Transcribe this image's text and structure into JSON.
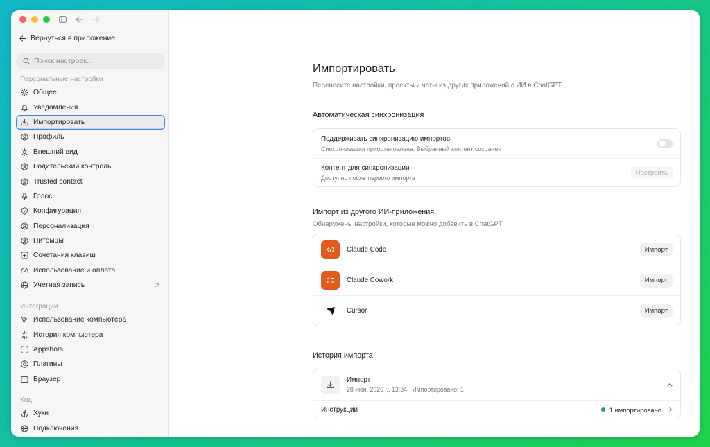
{
  "colors": {
    "accent_blue": "#3b82f6",
    "app_orange": "#e25a1c",
    "status_green": "#22a04b"
  },
  "sidebar": {
    "back_label": "Вернуться в приложение",
    "search_placeholder": "Поиск настроек...",
    "personal_label": "Персональные настройки",
    "personal_items": [
      {
        "label": "Общее",
        "icon": "gear-icon"
      },
      {
        "label": "Уведомления",
        "icon": "bell-icon"
      },
      {
        "label": "Импортировать",
        "icon": "download-icon",
        "active": true
      },
      {
        "label": "Профиль",
        "icon": "user-circle-icon"
      },
      {
        "label": "Внешний вид",
        "icon": "sun-icon"
      },
      {
        "label": "Родительский контроль",
        "icon": "user-circle-icon"
      },
      {
        "label": "Trusted contact",
        "icon": "user-circle-icon"
      },
      {
        "label": "Голос",
        "icon": "microphone-icon"
      },
      {
        "label": "Конфигурация",
        "icon": "shield-icon"
      },
      {
        "label": "Персонализация",
        "icon": "user-circle-icon"
      },
      {
        "label": "Питомцы",
        "icon": "user-circle-icon"
      },
      {
        "label": "Сочетания клавиш",
        "icon": "keyboard-icon"
      },
      {
        "label": "Использование и оплата",
        "icon": "gauge-icon"
      },
      {
        "label": "Учетная запись",
        "icon": "globe-icon",
        "external": true
      }
    ],
    "integrations_label": "Интеграции",
    "integration_items": [
      {
        "label": "Использование компьютера",
        "icon": "cursor-icon"
      },
      {
        "label": "История компьютера",
        "icon": "sparkle-icon"
      },
      {
        "label": "Appshots",
        "icon": "frame-icon"
      },
      {
        "label": "Плагины",
        "icon": "at-icon"
      },
      {
        "label": "Браузер",
        "icon": "browser-icon"
      }
    ],
    "code_label": "Код",
    "code_items": [
      {
        "label": "Хуки",
        "icon": "anchor-icon"
      },
      {
        "label": "Подключения",
        "icon": "globe-icon"
      }
    ]
  },
  "main": {
    "title": "Импортировать",
    "subtitle": "Перенесите настройки, проекты и чаты из других приложений с ИИ в ChatGPT",
    "sync": {
      "title": "Автоматическая синхронизация",
      "support_title": "Поддерживать синхронизацию импортов",
      "support_desc": "Синхронизация приостановлена. Выбранный контент сохранен",
      "toggle_on": false,
      "content_title": "Контент для синхронизации",
      "content_desc": "Доступно после первого импорта",
      "configure_label": "Настроить"
    },
    "other": {
      "title": "Импорт из другого ИИ-приложения",
      "subtitle": "Обнаружены настройки, которые можно добавить в ChatGPT",
      "apps": [
        {
          "name": "Claude Code",
          "icon": "code-icon",
          "button": "Импорт"
        },
        {
          "name": "Claude Cowork",
          "icon": "checklist-icon",
          "button": "Импорт"
        },
        {
          "name": "Cursor",
          "icon": "cursor-arrow-icon",
          "button": "Импорт"
        }
      ]
    },
    "history": {
      "title": "История импорта",
      "item_title": "Импорт",
      "item_date": "28 июн. 2026 г., 13:34",
      "item_count": "Импортировано: 1",
      "instructions_label": "Инструкции",
      "instructions_status": "1 импортировано"
    }
  }
}
